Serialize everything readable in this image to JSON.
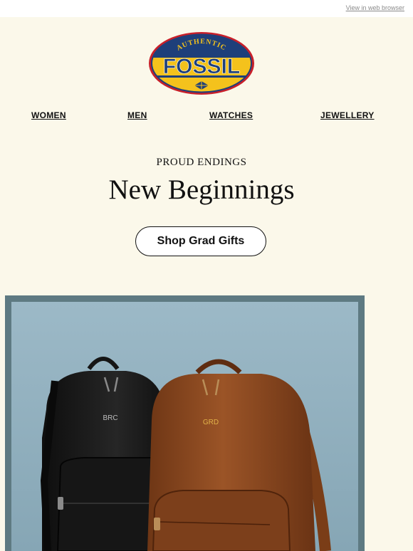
{
  "topbar": {
    "view_in_browser": "View in web browser"
  },
  "logo": {
    "arc_text": "AUTHENTIC",
    "brand": "FOSSIL"
  },
  "nav": {
    "items": [
      {
        "label": "WOMEN"
      },
      {
        "label": "MEN"
      },
      {
        "label": "WATCHES"
      },
      {
        "label": "JEWELLERY"
      }
    ]
  },
  "hero_text": {
    "kicker": "PROUD ENDINGS",
    "headline": "New Beginnings"
  },
  "cta": {
    "label": "Shop Grad Gifts"
  },
  "product_image": {
    "monogram_left": "BRC",
    "monogram_right": "GRD"
  },
  "colors": {
    "background": "#fbf8ea",
    "logo_navy": "#1e3f7a",
    "logo_yellow": "#f4c21c",
    "logo_red": "#c8202a",
    "frame": "#5e7a82",
    "backdrop": "#9bb8c6",
    "leather_brown": "#8a4a22"
  }
}
